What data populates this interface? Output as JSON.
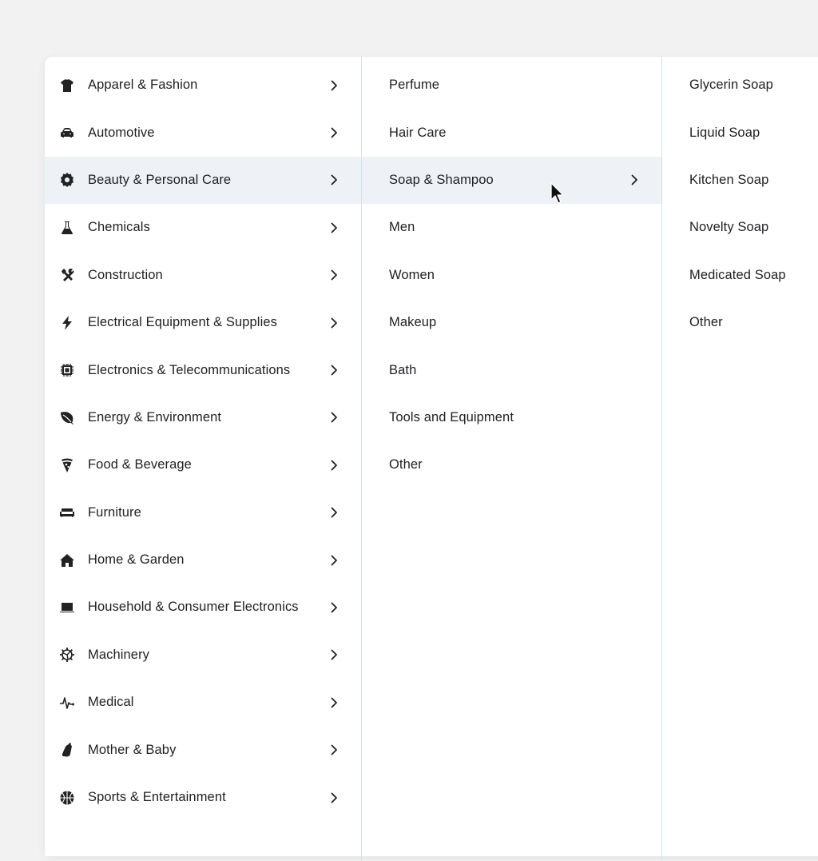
{
  "categories": [
    {
      "label": "Apparel & Fashion",
      "icon": "tshirt-icon"
    },
    {
      "label": "Automotive",
      "icon": "car-icon"
    },
    {
      "label": "Beauty & Personal Care",
      "icon": "gear-icon",
      "active": true
    },
    {
      "label": "Chemicals",
      "icon": "flask-icon"
    },
    {
      "label": "Construction",
      "icon": "tools-icon"
    },
    {
      "label": "Electrical Equipment & Supplies",
      "icon": "lightning-icon"
    },
    {
      "label": "Electronics & Telecommunications",
      "icon": "chip-icon"
    },
    {
      "label": "Energy & Environment",
      "icon": "leaf-icon"
    },
    {
      "label": "Food & Beverage",
      "icon": "pizza-icon"
    },
    {
      "label": "Furniture",
      "icon": "couch-icon"
    },
    {
      "label": "Home & Garden",
      "icon": "house-icon"
    },
    {
      "label": "Household & Consumer Electronics",
      "icon": "laptop-icon"
    },
    {
      "label": "Machinery",
      "icon": "cog-icon"
    },
    {
      "label": "Medical",
      "icon": "heartbeat-icon"
    },
    {
      "label": "Mother & Baby",
      "icon": "baby-bottle-icon"
    },
    {
      "label": "Sports & Entertainment",
      "icon": "basketball-icon"
    }
  ],
  "subcategories": [
    {
      "label": "Perfume"
    },
    {
      "label": "Hair Care"
    },
    {
      "label": "Soap & Shampoo",
      "active": true,
      "has_children": true
    },
    {
      "label": "Men"
    },
    {
      "label": "Women"
    },
    {
      "label": "Makeup"
    },
    {
      "label": "Bath"
    },
    {
      "label": "Tools and Equipment"
    },
    {
      "label": "Other"
    }
  ],
  "leaf_items": [
    {
      "label": "Glycerin Soap"
    },
    {
      "label": "Liquid Soap"
    },
    {
      "label": "Kitchen Soap"
    },
    {
      "label": "Novelty Soap"
    },
    {
      "label": "Medicated Soap"
    },
    {
      "label": "Other"
    }
  ],
  "colors": {
    "background": "#f2f2f2",
    "panel": "#ffffff",
    "active_row": "#eef2f7",
    "divider": "#d8e0e8",
    "text": "#1f1f24"
  }
}
